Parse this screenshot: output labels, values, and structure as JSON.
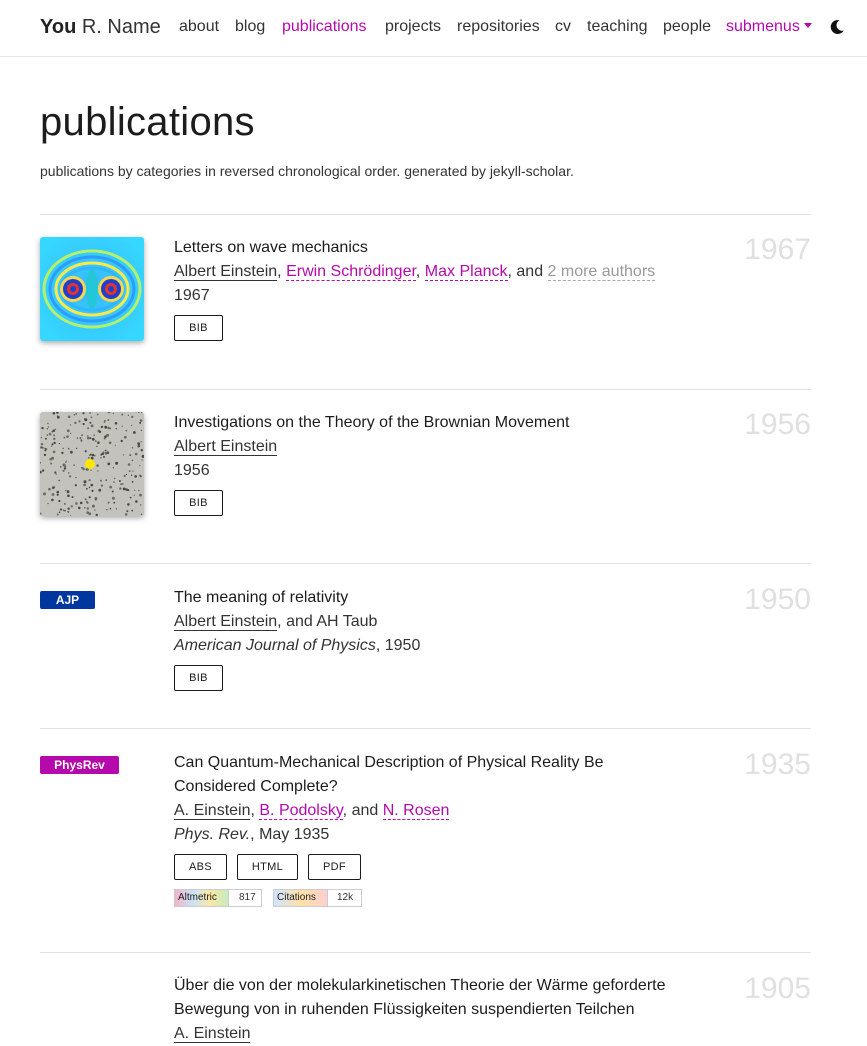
{
  "brand": {
    "first": "You",
    "rest": "R. Name"
  },
  "nav": {
    "items": [
      "about",
      "blog",
      "publications",
      "projects",
      "repositories",
      "cv",
      "teaching",
      "people"
    ],
    "submenus": "submenus"
  },
  "header": {
    "title": "publications",
    "description": "publications by categories in reversed chronological order. generated by jekyll-scholar."
  },
  "publications": [
    {
      "year_label": "1967",
      "title": "Letters on wave mechanics",
      "author_me": "Albert Einstein",
      "sep1": ", ",
      "author2": "Erwin Schrödinger",
      "sep2": ", ",
      "author3": "Max Planck",
      "sep3": ", and ",
      "more_authors": "2 more authors",
      "pub_line": "1967",
      "buttons": [
        "BIB"
      ]
    },
    {
      "year_label": "1956",
      "title": "Investigations on the Theory of the Brownian Movement",
      "author_me": "Albert Einstein",
      "pub_line": "1956",
      "buttons": [
        "BIB"
      ]
    },
    {
      "year_label": "1950",
      "abbr": "AJP",
      "abbr_color": "#00369f",
      "title": "The meaning of relativity",
      "author_me": "Albert Einstein",
      "sep1": ", and AH Taub",
      "journal": "American Journal of Physics",
      "journal_suffix": ", 1950",
      "buttons": [
        "BIB"
      ]
    },
    {
      "year_label": "1935",
      "abbr": "PhysRev",
      "abbr_color": "#b509ac",
      "title": "Can Quantum-Mechanical Description of Physical Reality Be Considered Complete?",
      "author_me": "A. Einstein",
      "sep1": ", ",
      "author2": "B. Podolsky",
      "sep2": ", and ",
      "author3": "N. Rosen",
      "journal": "Phys. Rev.",
      "journal_suffix": ", May 1935",
      "buttons": [
        "ABS",
        "HTML",
        "PDF"
      ],
      "altmetric": {
        "label": "Altmetric",
        "count": "817"
      },
      "citations": {
        "label": "Citations",
        "count": "12k"
      }
    },
    {
      "year_label": "1905",
      "title": "Über die von der molekularkinetischen Theorie der Wärme geforderte Bewegung von in ruhenden Flüssigkeiten suspendierten Teilchen",
      "author_me": "A. Einstein"
    }
  ],
  "colors": {
    "accent": "#b509ac",
    "ajp": "#00369f",
    "year": "#e0e0e0"
  }
}
